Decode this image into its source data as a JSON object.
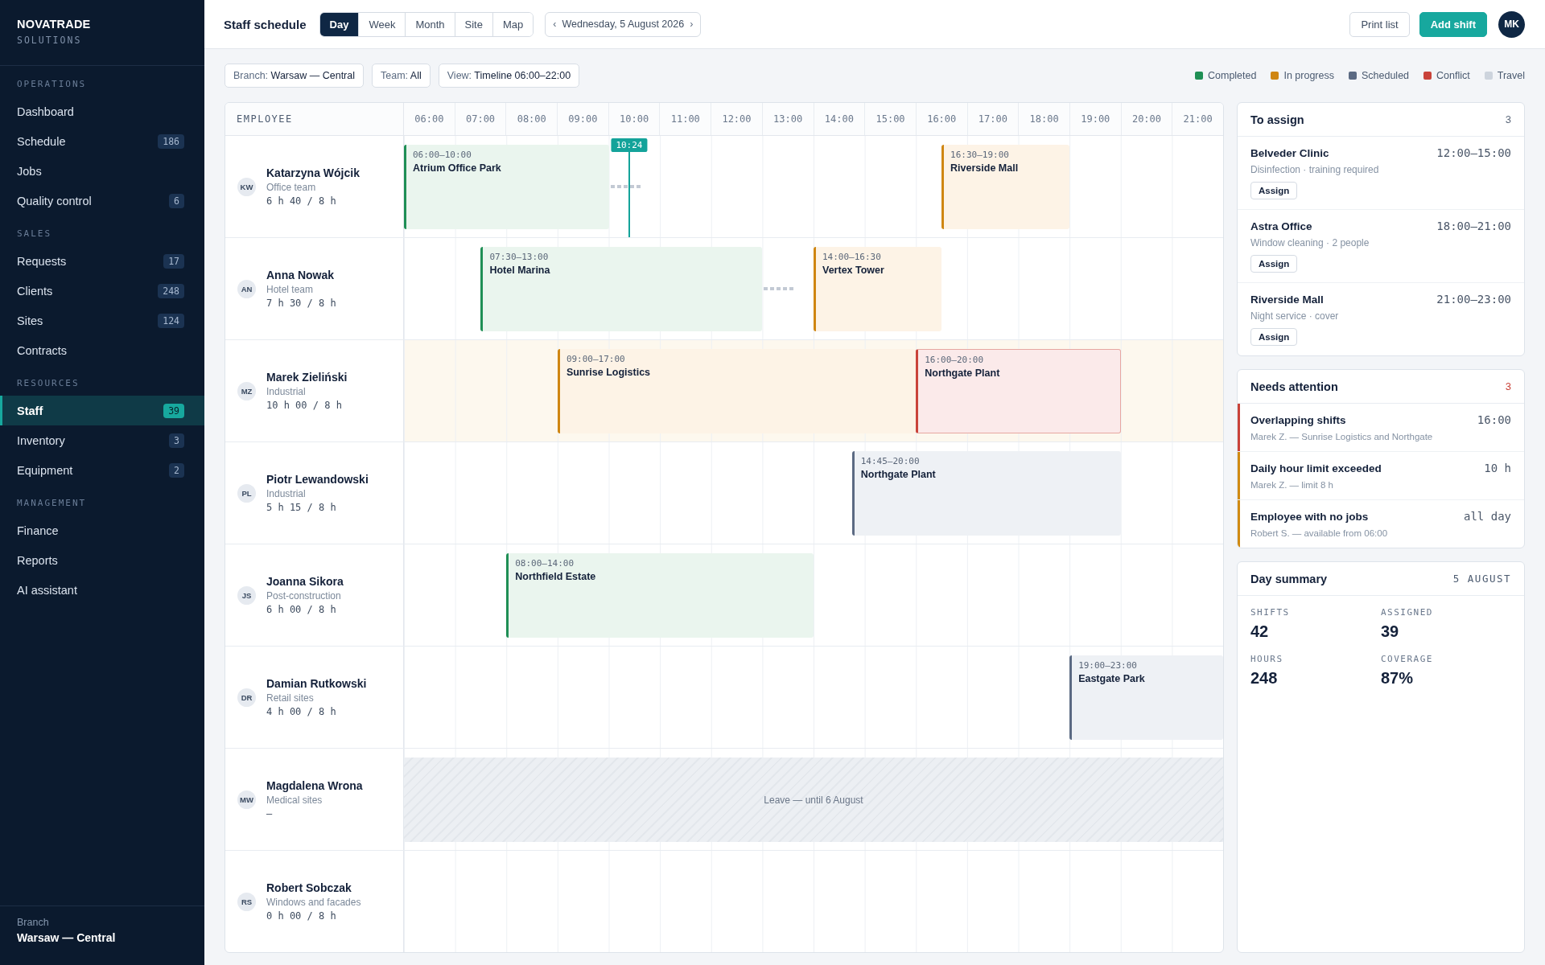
{
  "sidebar": {
    "brand": {
      "name": "NOVATRADE",
      "tagline": "SOLUTIONS"
    },
    "sections": [
      {
        "title": "OPERATIONS",
        "items": [
          {
            "label": "Dashboard",
            "selected": false
          },
          {
            "label": "Schedule",
            "badge": "186",
            "selected": false
          },
          {
            "label": "Jobs",
            "selected": false
          },
          {
            "label": "Quality control",
            "badge": "6",
            "selected": false
          }
        ]
      },
      {
        "title": "SALES",
        "items": [
          {
            "label": "Requests",
            "badge": "17",
            "selected": false
          },
          {
            "label": "Clients",
            "badge": "248",
            "selected": false
          },
          {
            "label": "Sites",
            "badge": "124",
            "selected": false
          },
          {
            "label": "Contracts",
            "selected": false
          }
        ]
      },
      {
        "title": "RESOURCES",
        "items": [
          {
            "label": "Staff",
            "badge": "39",
            "selected": true
          },
          {
            "label": "Inventory",
            "badge": "3",
            "selected": false
          },
          {
            "label": "Equipment",
            "badge": "2",
            "selected": false
          }
        ]
      },
      {
        "title": "MANAGEMENT",
        "items": [
          {
            "label": "Finance",
            "selected": false
          },
          {
            "label": "Reports",
            "selected": false
          },
          {
            "label": "AI assistant",
            "selected": false
          }
        ]
      }
    ],
    "footer": {
      "label": "Branch",
      "value": "Warsaw — Central"
    }
  },
  "header": {
    "title": "Staff schedule",
    "views": [
      {
        "label": "Day",
        "selected": true
      },
      {
        "label": "Week",
        "selected": false
      },
      {
        "label": "Month",
        "selected": false
      },
      {
        "label": "Site",
        "selected": false
      },
      {
        "label": "Map",
        "selected": false
      }
    ],
    "date_nav": {
      "prev": "‹",
      "date": "Wednesday, 5 August 2026",
      "next": "›"
    },
    "actions": [
      {
        "label": "Print list",
        "kind": "secondary"
      },
      {
        "label": "Add shift",
        "kind": "primary"
      }
    ],
    "user_initials": "MK"
  },
  "filters": [
    {
      "label": "Branch:",
      "value": "Warsaw — Central"
    },
    {
      "label": "Team:",
      "value": "All"
    },
    {
      "label": "View:",
      "value": "Timeline 06:00–22:00"
    }
  ],
  "legend": [
    {
      "label": "Completed",
      "color": "#1f8f55"
    },
    {
      "label": "In progress",
      "color": "#cf8612"
    },
    {
      "label": "Scheduled",
      "color": "#5b6a83"
    },
    {
      "label": "Conflict",
      "color": "#c9433a"
    },
    {
      "label": "Travel",
      "color": "#cdd4dd"
    }
  ],
  "timeline": {
    "column_label": "EMPLOYEE",
    "hours": [
      "06:00",
      "07:00",
      "08:00",
      "09:00",
      "10:00",
      "11:00",
      "12:00",
      "13:00",
      "14:00",
      "15:00",
      "16:00",
      "17:00",
      "18:00",
      "19:00",
      "20:00",
      "21:00"
    ],
    "now_marker": "10:24",
    "employees": [
      {
        "initials": "KW",
        "name": "Katarzyna Wójcik",
        "team": "Office team",
        "hours": "6 h 40 / 8 h",
        "flagged": false,
        "shifts": [
          {
            "time": "06:00–10:00",
            "site": "Atrium Office Park",
            "kind": "completed",
            "travel_after": true
          },
          {
            "time": "16:30–19:00",
            "site": "Riverside Mall",
            "kind": "in_progress",
            "travel_after": false
          }
        ]
      },
      {
        "initials": "AN",
        "name": "Anna Nowak",
        "team": "Hotel team",
        "hours": "7 h 30 / 8 h",
        "flagged": false,
        "shifts": [
          {
            "time": "07:30–13:00",
            "site": "Hotel Marina",
            "kind": "completed",
            "travel_after": true
          },
          {
            "time": "14:00–16:30",
            "site": "Vertex Tower",
            "kind": "in_progress",
            "travel_after": false
          }
        ]
      },
      {
        "initials": "MZ",
        "name": "Marek Zieliński",
        "team": "Industrial",
        "hours": "10 h 00 / 8 h",
        "flagged": true,
        "shifts": [
          {
            "time": "09:00–17:00",
            "site": "Sunrise Logistics",
            "kind": "in_progress",
            "travel_after": false
          },
          {
            "time": "16:00–20:00",
            "site": "Northgate Plant",
            "kind": "conflict",
            "travel_after": false
          }
        ]
      },
      {
        "initials": "PL",
        "name": "Piotr Lewandowski",
        "team": "Industrial",
        "hours": "5 h 15 / 8 h",
        "flagged": false,
        "shifts": [
          {
            "time": "14:45–20:00",
            "site": "Northgate Plant",
            "kind": "scheduled",
            "travel_after": false
          }
        ]
      },
      {
        "initials": "JS",
        "name": "Joanna Sikora",
        "team": "Post-construction",
        "hours": "6 h 00 / 8 h",
        "flagged": false,
        "shifts": [
          {
            "time": "08:00–14:00",
            "site": "Northfield Estate",
            "kind": "completed",
            "travel_after": false
          }
        ]
      },
      {
        "initials": "DR",
        "name": "Damian Rutkowski",
        "team": "Retail sites",
        "hours": "4 h 00 / 8 h",
        "flagged": false,
        "shifts": [
          {
            "time": "19:00–23:00",
            "site": "Eastgate Park",
            "kind": "scheduled",
            "travel_after": false
          }
        ]
      },
      {
        "initials": "MW",
        "name": "Magdalena Wrona",
        "team": "Medical sites",
        "hours": "–",
        "flagged": false,
        "leave": "Leave — until 6 August"
      },
      {
        "initials": "RS",
        "name": "Robert Sobczak",
        "team": "Windows and facades",
        "hours": "0 h 00 / 8 h",
        "flagged": false
      }
    ]
  },
  "to_assign": {
    "title": "To assign",
    "count": "3",
    "items": [
      {
        "site": "Belveder Clinic",
        "time": "12:00–15:00",
        "detail": "Disinfection · training required",
        "action": "Assign"
      },
      {
        "site": "Astra Office",
        "time": "18:00–21:00",
        "detail": "Window cleaning · 2 people",
        "action": "Assign"
      },
      {
        "site": "Riverside Mall",
        "time": "21:00–23:00",
        "detail": "Night service · cover",
        "action": "Assign"
      }
    ]
  },
  "needs_attention": {
    "title": "Needs attention",
    "count": "3",
    "items": [
      {
        "title": "Overlapping shifts",
        "value": "16:00",
        "detail": "Marek Z. — Sunrise Logistics and Northgate",
        "color": "#c9433a"
      },
      {
        "title": "Daily hour limit exceeded",
        "value": "10 h",
        "detail": "Marek Z. — limit 8 h",
        "color": "#d08a12"
      },
      {
        "title": "Employee with no jobs",
        "value": "all day",
        "detail": "Robert S. — available from 06:00",
        "color": "#d08a12"
      }
    ]
  },
  "day_summary": {
    "title": "Day summary",
    "date": "5 AUGUST",
    "stats": [
      {
        "label": "SHIFTS",
        "value": "42"
      },
      {
        "label": "ASSIGNED",
        "value": "39"
      },
      {
        "label": "HOURS",
        "value": "248"
      },
      {
        "label": "COVERAGE",
        "value": "87%"
      }
    ]
  }
}
